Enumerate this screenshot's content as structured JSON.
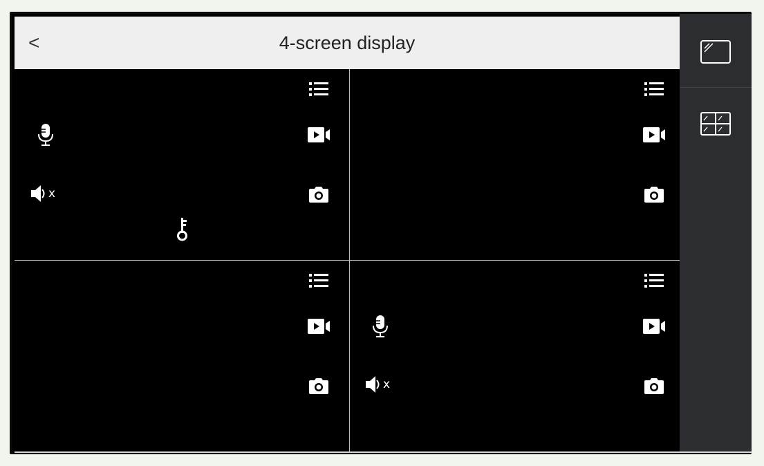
{
  "header": {
    "back_label": "<",
    "title": "4-screen display"
  },
  "sidebar": {
    "items": [
      {
        "name": "single-screen",
        "icon": "single-screen-icon",
        "selected": false
      },
      {
        "name": "four-screen",
        "icon": "four-screen-icon",
        "selected": true
      }
    ]
  },
  "panes": [
    {
      "id": 1,
      "icons": [
        "microphone-icon",
        "speaker-muted-icon",
        "unlock-key-icon",
        "menu-list-icon",
        "record-video-icon",
        "snapshot-camera-icon"
      ],
      "mute_mark": "x"
    },
    {
      "id": 2,
      "icons": [
        "menu-list-icon",
        "record-video-icon",
        "snapshot-camera-icon"
      ]
    },
    {
      "id": 3,
      "icons": [
        "menu-list-icon",
        "record-video-icon",
        "snapshot-camera-icon"
      ]
    },
    {
      "id": 4,
      "icons": [
        "microphone-icon",
        "speaker-muted-icon",
        "menu-list-icon",
        "record-video-icon",
        "snapshot-camera-icon"
      ],
      "mute_mark": "x"
    }
  ],
  "colors": {
    "background": "#000000",
    "header": "#efefef",
    "sidebar": "#2c2d31",
    "icon": "#ffffff",
    "divider": "#bdbdbd"
  }
}
